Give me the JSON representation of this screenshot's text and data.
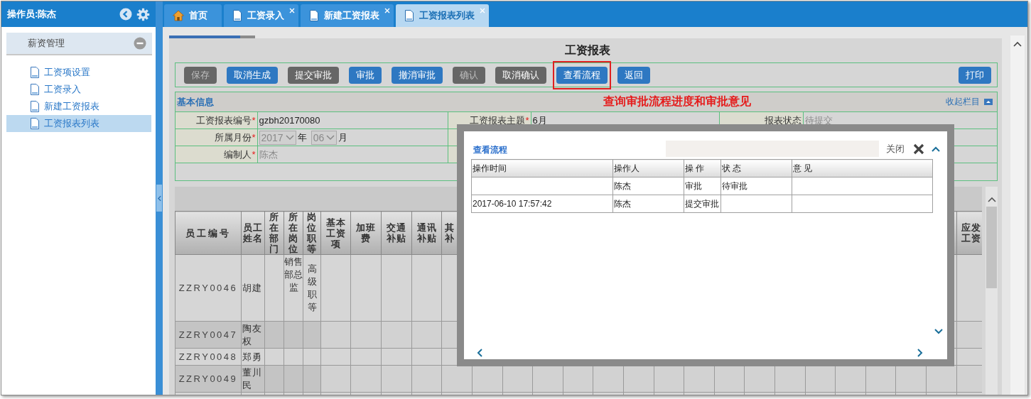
{
  "sidebar": {
    "operator": "操作员:陈杰",
    "section": {
      "title": "薪资管理",
      "expanded": true
    },
    "items": [
      {
        "label": "工资项设置",
        "selected": false
      },
      {
        "label": "工资录入",
        "selected": false
      },
      {
        "label": "新建工资报表",
        "selected": false
      },
      {
        "label": "工资报表列表",
        "selected": true
      }
    ]
  },
  "tabs": [
    {
      "label": "首页",
      "kind": "home",
      "closable": false,
      "selected": false
    },
    {
      "label": "工资录入",
      "kind": "page",
      "closable": true,
      "selected": false
    },
    {
      "label": "新建工资报表",
      "kind": "page",
      "closable": true,
      "selected": false
    },
    {
      "label": "工资报表列表",
      "kind": "page",
      "closable": true,
      "selected": true
    }
  ],
  "loading_bar": {
    "level": 0.83
  },
  "page_title": "工资报表",
  "toolbar": {
    "buttons": [
      {
        "label": "保存",
        "kind": "secondary",
        "disabled": true,
        "highlighted": false
      },
      {
        "label": "取消生成",
        "kind": "primary",
        "disabled": false,
        "highlighted": false
      },
      {
        "label": "提交审批",
        "kind": "secondary",
        "disabled": false,
        "highlighted": false
      },
      {
        "label": "审批",
        "kind": "primary",
        "disabled": false,
        "highlighted": false
      },
      {
        "label": "撤消审批",
        "kind": "primary",
        "disabled": false,
        "highlighted": false
      },
      {
        "label": "确认",
        "kind": "secondary",
        "disabled": true,
        "highlighted": false
      },
      {
        "label": "取消确认",
        "kind": "secondary",
        "disabled": false,
        "highlighted": false
      },
      {
        "label": "查看流程",
        "kind": "primary",
        "disabled": false,
        "highlighted": true
      },
      {
        "label": "返回",
        "kind": "primary",
        "disabled": false,
        "highlighted": false
      }
    ],
    "print_button": "打印"
  },
  "info": {
    "title": "基本信息",
    "required_mark": "*",
    "annotation": "查询审批流程进度和审批意见",
    "collapse_link": "收起栏目",
    "rows": [
      [
        {
          "kind": "text",
          "label": "工资报表编号",
          "required": true,
          "value": "gzbh20170080",
          "readonly": false
        },
        {
          "kind": "text",
          "label": "工资报表主题",
          "required": true,
          "value": "6月",
          "readonly": false
        },
        {
          "kind": "text",
          "label": "报表状态",
          "required": false,
          "value": "待提交",
          "readonly": true
        }
      ],
      [
        {
          "kind": "month",
          "label": "所属月份",
          "required": true,
          "year": "2017",
          "year_unit": "年",
          "month": "06",
          "month_unit": "月",
          "readonly": true
        }
      ],
      [
        {
          "kind": "text",
          "label": "编制人",
          "required": true,
          "value": "陈杰",
          "readonly": true
        }
      ]
    ]
  },
  "table": {
    "columns": [
      {
        "label": "员工编号"
      },
      {
        "label": "员工姓名"
      },
      {
        "label": "所在部门"
      },
      {
        "label": "所在岗位"
      },
      {
        "label": "岗位职等"
      },
      {
        "label": "基本工资项"
      },
      {
        "label": "加班费"
      },
      {
        "label": "交通补贴"
      },
      {
        "label": "通讯补贴"
      },
      {
        "label": "其补"
      }
    ],
    "last_column": {
      "label": "应发工资"
    },
    "rows": [
      {
        "id": "ZZRY0046",
        "name": "胡建",
        "position": "销售部总监",
        "grade": "高级职等"
      },
      {
        "id": "ZZRY0047",
        "name": "陶友权"
      },
      {
        "id": "ZZRY0048",
        "name": "郑勇"
      },
      {
        "id": "ZZRY0049",
        "name": "董川民"
      }
    ]
  },
  "dialog": {
    "title": "查看流程",
    "close_label": "关闭",
    "columns": [
      "操作时间",
      "操作人",
      "操 作",
      "状 态",
      "意 见"
    ],
    "rows": [
      {
        "operator": "陈杰",
        "action": "审批",
        "status": "待审批"
      },
      {
        "time": "2017-06-10 17:57:42",
        "operator": "陈杰",
        "action": "提交审批"
      }
    ]
  }
}
